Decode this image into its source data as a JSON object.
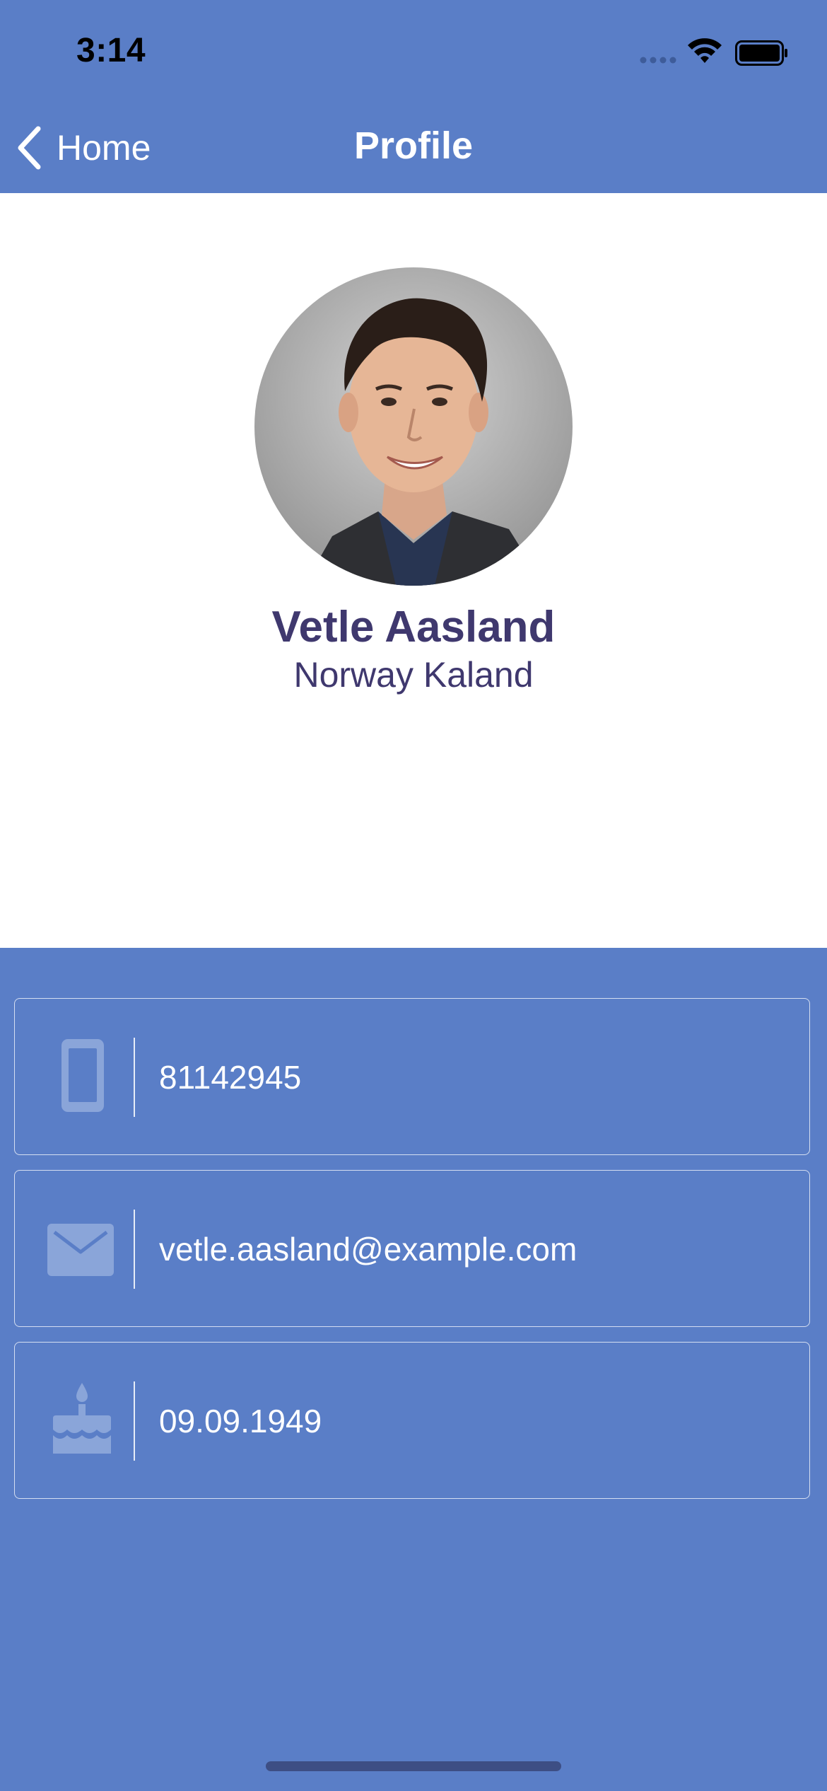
{
  "status_bar": {
    "time": "3:14"
  },
  "nav": {
    "back_label": "Home",
    "title": "Profile"
  },
  "profile": {
    "name": "Vetle Aasland",
    "location": "Norway Kaland"
  },
  "contact": {
    "phone": {
      "icon": "phone-icon",
      "value": "81142945"
    },
    "email": {
      "icon": "mail-icon",
      "value": "vetle.aasland@example.com"
    },
    "birthday": {
      "icon": "birthday-cake-icon",
      "value": "09.09.1949"
    }
  },
  "colors": {
    "brand": "#5A7EC7",
    "name_text": "#3F386E",
    "icon_tint": "#8AA5D9"
  }
}
